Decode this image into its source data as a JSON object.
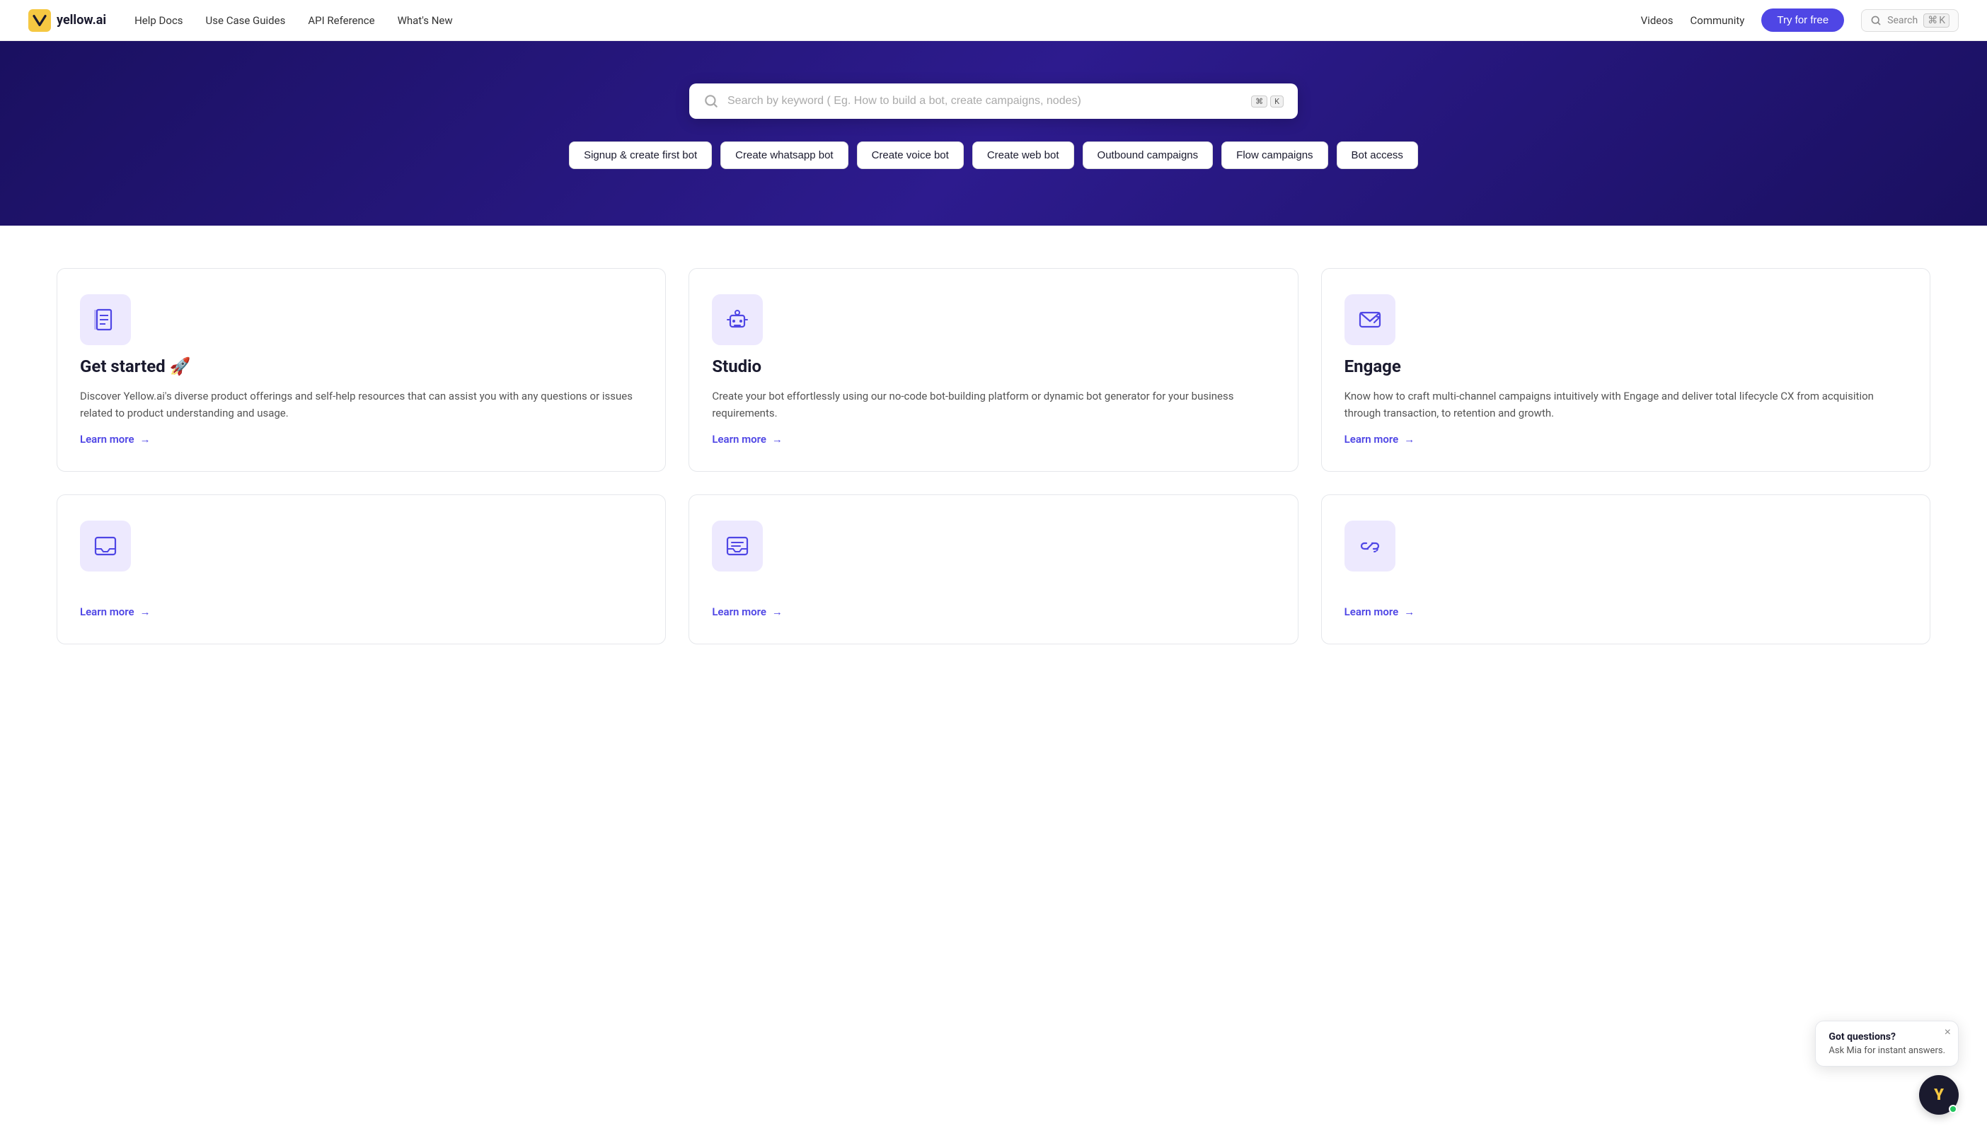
{
  "brand": {
    "name": "yellow.ai",
    "logo_text": "Y"
  },
  "navbar": {
    "links": [
      {
        "label": "Help Docs",
        "id": "help-docs"
      },
      {
        "label": "Use Case Guides",
        "id": "use-case-guides"
      },
      {
        "label": "API Reference",
        "id": "api-reference"
      },
      {
        "label": "What's New",
        "id": "whats-new"
      }
    ],
    "right_links": [
      {
        "label": "Videos",
        "id": "videos"
      },
      {
        "label": "Community",
        "id": "community"
      }
    ],
    "try_button": "Try for free",
    "search_placeholder": "Search",
    "search_key1": "⌘",
    "search_key2": "K"
  },
  "hero": {
    "search_placeholder": "Search by keyword ( Eg. How to build a bot, create campaigns, nodes)",
    "search_key1": "⌘",
    "search_key2": "K",
    "chips": [
      "Signup & create first bot",
      "Create whatsapp bot",
      "Create voice bot",
      "Create web bot",
      "Outbound campaigns",
      "Flow campaigns",
      "Bot access"
    ]
  },
  "cards": [
    {
      "id": "get-started",
      "icon": "book",
      "title": "Get started 🚀",
      "desc": "Discover Yellow.ai's diverse product offerings and self-help resources that can assist you with any questions or issues related to product understanding and usage.",
      "learn_more": "Learn more"
    },
    {
      "id": "studio",
      "icon": "robot",
      "title": "Studio",
      "desc": "Create your bot effortlessly using our no-code bot-building platform or dynamic bot generator for your business requirements.",
      "learn_more": "Learn more"
    },
    {
      "id": "engage",
      "icon": "email-send",
      "title": "Engage",
      "desc": "Know how to craft multi-channel campaigns intuitively with Engage and deliver total lifecycle CX from acquisition through transaction, to retention and growth.",
      "learn_more": "Learn more"
    },
    {
      "id": "inbox",
      "icon": "inbox",
      "title": "",
      "desc": "",
      "learn_more": "Learn more"
    },
    {
      "id": "inbox2",
      "icon": "inbox2",
      "title": "",
      "desc": "",
      "learn_more": "Learn more"
    },
    {
      "id": "link",
      "icon": "link",
      "title": "",
      "desc": "",
      "learn_more": "Learn more"
    }
  ],
  "chat_widget": {
    "title": "Got questions?",
    "subtitle": "Ask Mia for instant answers.",
    "close_label": "×",
    "avatar_letter": "Y"
  }
}
